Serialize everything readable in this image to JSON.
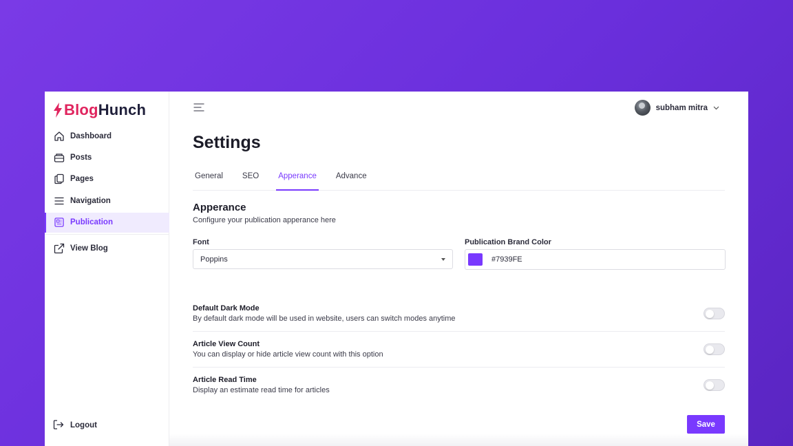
{
  "brand": {
    "part1": "Blog",
    "part2": "Hunch",
    "accent": "#e0245e"
  },
  "sidebar": {
    "items": [
      {
        "label": "Dashboard",
        "icon": "home-icon"
      },
      {
        "label": "Posts",
        "icon": "posts-icon"
      },
      {
        "label": "Pages",
        "icon": "pages-icon"
      },
      {
        "label": "Navigation",
        "icon": "menu-icon"
      },
      {
        "label": "Publication",
        "icon": "publication-icon",
        "active": true
      }
    ],
    "view_blog": "View Blog",
    "logout": "Logout"
  },
  "header": {
    "user_name": "subham mitra"
  },
  "page": {
    "title": "Settings"
  },
  "tabs": [
    {
      "label": "General"
    },
    {
      "label": "SEO"
    },
    {
      "label": "Apperance",
      "active": true
    },
    {
      "label": "Advance"
    }
  ],
  "appearance": {
    "title": "Apperance",
    "subtitle": "Configure your publication apperance here",
    "font_label": "Font",
    "font_value": "Poppins",
    "brand_color_label": "Publication Brand Color",
    "brand_color_value": "#7939FE"
  },
  "settings": [
    {
      "title": "Default Dark Mode",
      "desc": "By default dark mode will be used in website, users can switch modes anytime",
      "enabled": false
    },
    {
      "title": "Article View Count",
      "desc": "You can display or hide article view count with this option",
      "enabled": false
    },
    {
      "title": "Article Read Time",
      "desc": "Display an estimate read time for articles",
      "enabled": false
    }
  ],
  "actions": {
    "save": "Save"
  },
  "colors": {
    "primary": "#7939fe",
    "background": "#6a2fdc"
  }
}
